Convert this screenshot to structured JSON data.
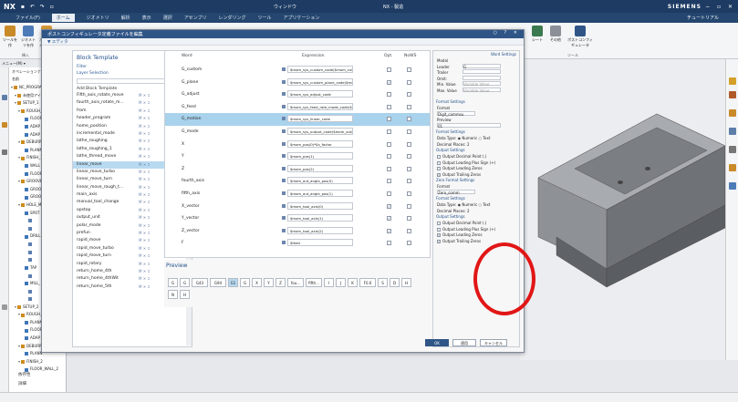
{
  "titlebar": {
    "app": "NX",
    "window_title": "NX - 製造",
    "brand": "SIEMENS",
    "window_menu": "ウィンドウ",
    "controls": "− ▫ ✕"
  },
  "menubar": {
    "items": [
      "ファイル(F)",
      "ホーム",
      "ジオメトリ",
      "解析",
      "表示",
      "選択",
      "アセンブリ",
      "レンダリング",
      "ツール",
      "アプリケーション"
    ],
    "active": 1,
    "tutorial": "チュートリアル"
  },
  "ribbon": {
    "buttons": [
      "ツールを作",
      "ジオメトリを作",
      "オペレーションを作"
    ],
    "group_label": "挿入",
    "right_buttons": [
      "シート",
      "その他",
      "ポストコンフィギュレータ"
    ],
    "right_group": "ツール"
  },
  "filterbar": {
    "label": "メニュー(M) ▾"
  },
  "navigator": {
    "title": "オペレーションナビゲータ",
    "col": "名前",
    "rows": [
      {
        "label": "NC_PROGRAM",
        "indent": 0
      },
      {
        "label": "未使用アイテム",
        "indent": 1
      },
      {
        "label": "SETUP_1",
        "indent": 1
      },
      {
        "label": "ROUGH_1",
        "indent": 2
      },
      {
        "label": "FLOOR",
        "indent": 3
      },
      {
        "label": "ADAP",
        "indent": 3
      },
      {
        "label": "ADAP",
        "indent": 3
      },
      {
        "label": "DEBURR",
        "indent": 2
      },
      {
        "label": "PLANN",
        "indent": 3
      },
      {
        "label": "FINISH_1",
        "indent": 2
      },
      {
        "label": "WALL",
        "indent": 3
      },
      {
        "label": "FLOOR",
        "indent": 3
      },
      {
        "label": "GROOVE",
        "indent": 2
      },
      {
        "label": "GROO",
        "indent": 3
      },
      {
        "label": "GROO",
        "indent": 3
      },
      {
        "label": "HOLE_MA",
        "indent": 2
      },
      {
        "label": "SPOT",
        "indent": 3
      },
      {
        "label": "",
        "indent": 4
      },
      {
        "label": "",
        "indent": 4
      },
      {
        "label": "DRILL",
        "indent": 3
      },
      {
        "label": "",
        "indent": 4
      },
      {
        "label": "",
        "indent": 4
      },
      {
        "label": "",
        "indent": 4
      },
      {
        "label": "TAP",
        "indent": 3
      },
      {
        "label": "",
        "indent": 4
      },
      {
        "label": "MILL_",
        "indent": 3
      },
      {
        "label": "",
        "indent": 4
      },
      {
        "label": "",
        "indent": 4
      },
      {
        "label": "SETUP_2",
        "indent": 1
      },
      {
        "label": "ROUGH_2",
        "indent": 2
      },
      {
        "label": "PLANN",
        "indent": 3
      },
      {
        "label": "FLOOR",
        "indent": 3
      },
      {
        "label": "ADAP",
        "indent": 3
      },
      {
        "label": "DEBURR",
        "indent": 2
      },
      {
        "label": "PLANN",
        "indent": 3
      },
      {
        "label": "FINISH_2",
        "indent": 2
      },
      {
        "label": "FLOOR_WALL_2",
        "indent": 3
      }
    ],
    "footer": [
      "依存性",
      "詳細"
    ]
  },
  "dialog": {
    "title": "ポストコンフィギュレータ定義ファイルを編集",
    "subtitle": "▼ エディタ",
    "controls": "○ ? ✕",
    "block_template": {
      "title": "Block Template",
      "filter_label": "Filter",
      "layer_label": "Layer Selection",
      "add_label": "Add Block Template",
      "rows": [
        "Fifth_axis_rotate_move",
        "fourth_axis_rotate_m...",
        "from",
        "header_program",
        "home_position",
        "incremental_mode",
        "lathe_roughing",
        "lathe_roughing_1",
        "lathe_thread_move",
        "linear_move",
        "linear_move_turbo",
        "linear_move_turn",
        "linear_move_rough_t...",
        "main_axis",
        "manual_tool_change",
        "opstop",
        "output_unit",
        "polar_mode",
        "prefun",
        "rapid_move",
        "rapid_move_turbo",
        "rapid_move_turn",
        "rapid_rotary",
        "return_home_4th",
        "return_home_4thWit",
        "return_home_5th"
      ],
      "selected": 9,
      "marks": "M ✕ ↕"
    },
    "table": {
      "headers": [
        "Word",
        "Expression",
        "Opt.",
        "NoWS"
      ],
      "rows": [
        {
          "word": "G_custom",
          "expr": "$mom_sys_custom_code($mom_custom_pause)",
          "opt": false,
          "nows": false
        },
        {
          "word": "G_plane",
          "expr": "$mom_sys_custom_plane_code($mom_pos...",
          "opt": true,
          "nows": false
        },
        {
          "word": "G_adjust",
          "expr": "$mom_sys_adjust_code",
          "opt": false,
          "nows": false
        },
        {
          "word": "G_feed",
          "expr": "$mom_sys_feed_rate_mode_code($feed_mode)",
          "opt": false,
          "nows": false
        },
        {
          "word": "G_motion",
          "expr": "$mom_sys_linear_code",
          "opt": false,
          "nows": false
        },
        {
          "word": "G_mode",
          "expr": "$mom_sys_output_code($mom_output_mode)",
          "opt": false,
          "nows": false
        },
        {
          "word": "X",
          "expr": "$mom_pos(0)*$x_factor",
          "opt": false,
          "nows": false
        },
        {
          "word": "Y",
          "expr": "$mom_pos(1)",
          "opt": false,
          "nows": false
        },
        {
          "word": "Z",
          "expr": "$mom_pos(2)",
          "opt": false,
          "nows": false
        },
        {
          "word": "fourth_axis",
          "expr": "$mom_out_angle_pos(0)",
          "opt": false,
          "nows": false
        },
        {
          "word": "fifth_axis",
          "expr": "$mom_out_angle_pos(1)",
          "opt": false,
          "nows": false
        },
        {
          "word": "X_vector",
          "expr": "$mom_tool_axis(0)",
          "opt": true,
          "nows": false
        },
        {
          "word": "Y_vector",
          "expr": "$mom_tool_axis(1)",
          "opt": true,
          "nows": false
        },
        {
          "word": "Z_vector",
          "expr": "$mom_tool_axis(2)",
          "opt": true,
          "nows": false
        },
        {
          "word": "F",
          "expr": "$feed",
          "opt": false,
          "nows": false
        }
      ],
      "selected": 4
    },
    "preview": {
      "title": "Preview",
      "row1": [
        "G",
        "G",
        "G43",
        "G94",
        "G1",
        "G",
        "X",
        "Y",
        "Z",
        "fou...",
        "fifth...",
        "I",
        "J",
        "K",
        "F0.0",
        "S",
        "D",
        "H"
      ],
      "row2": [
        "N",
        "H"
      ],
      "selected": 4
    },
    "settings": {
      "word_settings": "Word Settings",
      "fields": [
        "Modal",
        "Leader",
        "Trailer",
        "Omit:",
        "Min. Value",
        "Max. Value"
      ],
      "leader_value": "G",
      "min_placeholder": "Variable Value",
      "max_placeholder": "Variable Value",
      "format_settings": "Format Settings",
      "format_label": "Format",
      "format_value": "Digit_commsu",
      "preview_label": "Preview",
      "preview_value": "01",
      "fmt2_label": "Format Settings",
      "data_type": "Data Type:",
      "numeric": "Numeric",
      "text": "Text",
      "decimal_places": "Decimal Places:",
      "dp_value": "2",
      "output_settings": "Output Settings",
      "checks": [
        "Output Decimal Point (.)",
        "Output Leading Plus Sign (+)",
        "Output Leading Zeros",
        "Output Trailing Zeros"
      ],
      "zero_format": "Zero Format Settings",
      "zero_format_value": "Zero_comm",
      "zero_checks": [
        "Output Decimal Point (.)",
        "Output Leading Plus Sign (+)",
        "Output Leading Zeros",
        "Output Trailing Zeros"
      ]
    },
    "buttons": {
      "ok": "OK",
      "apply": "適用",
      "cancel": "キャンセル"
    }
  },
  "annotation_color": "#e11616"
}
